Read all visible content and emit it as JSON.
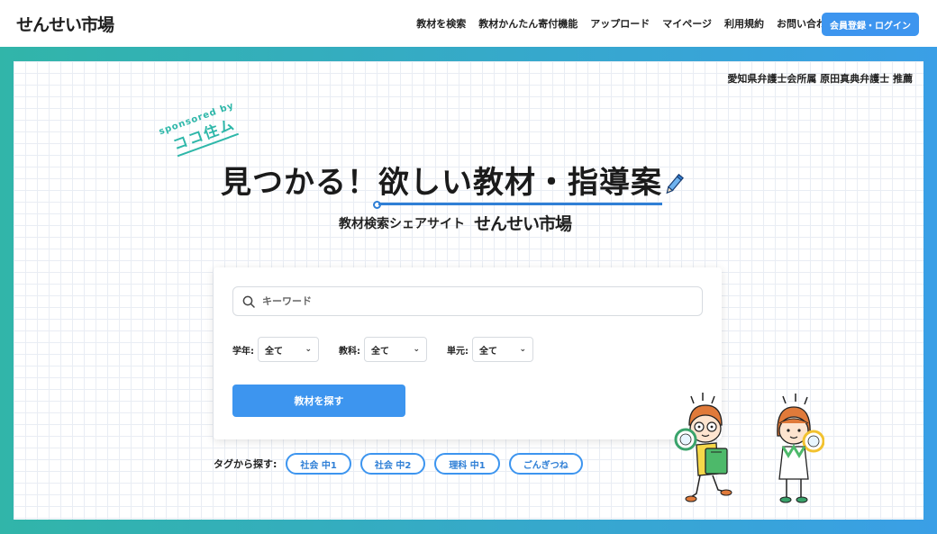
{
  "header": {
    "logo": "せんせい市場",
    "nav": [
      {
        "label": "教材を検索"
      },
      {
        "label": "教材かんたん寄付機能"
      },
      {
        "label": "アップロード"
      },
      {
        "label": "マイページ"
      },
      {
        "label": "利用規約"
      },
      {
        "label": "お問い合わせ"
      }
    ],
    "register_label": "会員登録・ログイン"
  },
  "hero": {
    "recommend": "愛知県弁護士会所属 原田真典弁護士 推薦",
    "sponsor_by": "sponsored by",
    "sponsor_name": "ココ住ム",
    "headline_prefix": "見つかる！",
    "headline_highlight": "欲しい教材・指導案",
    "subline": "教材検索シェアサイト",
    "subline_brand": "せんせい市場"
  },
  "search": {
    "placeholder": "キーワード",
    "filters": [
      {
        "label": "学年:",
        "value": "全て"
      },
      {
        "label": "教科:",
        "value": "全て"
      },
      {
        "label": "単元:",
        "value": "全て"
      }
    ],
    "button_label": "教材を探す"
  },
  "tags": {
    "label": "タグから探す:",
    "items": [
      "社会 中1",
      "社会 中2",
      "理科 中1",
      "ごんぎつね"
    ]
  },
  "colors": {
    "accent": "#3d95ef",
    "teal": "#2eb7a9",
    "frame_left": "#31b5a9",
    "frame_right": "#3a9fe6"
  }
}
